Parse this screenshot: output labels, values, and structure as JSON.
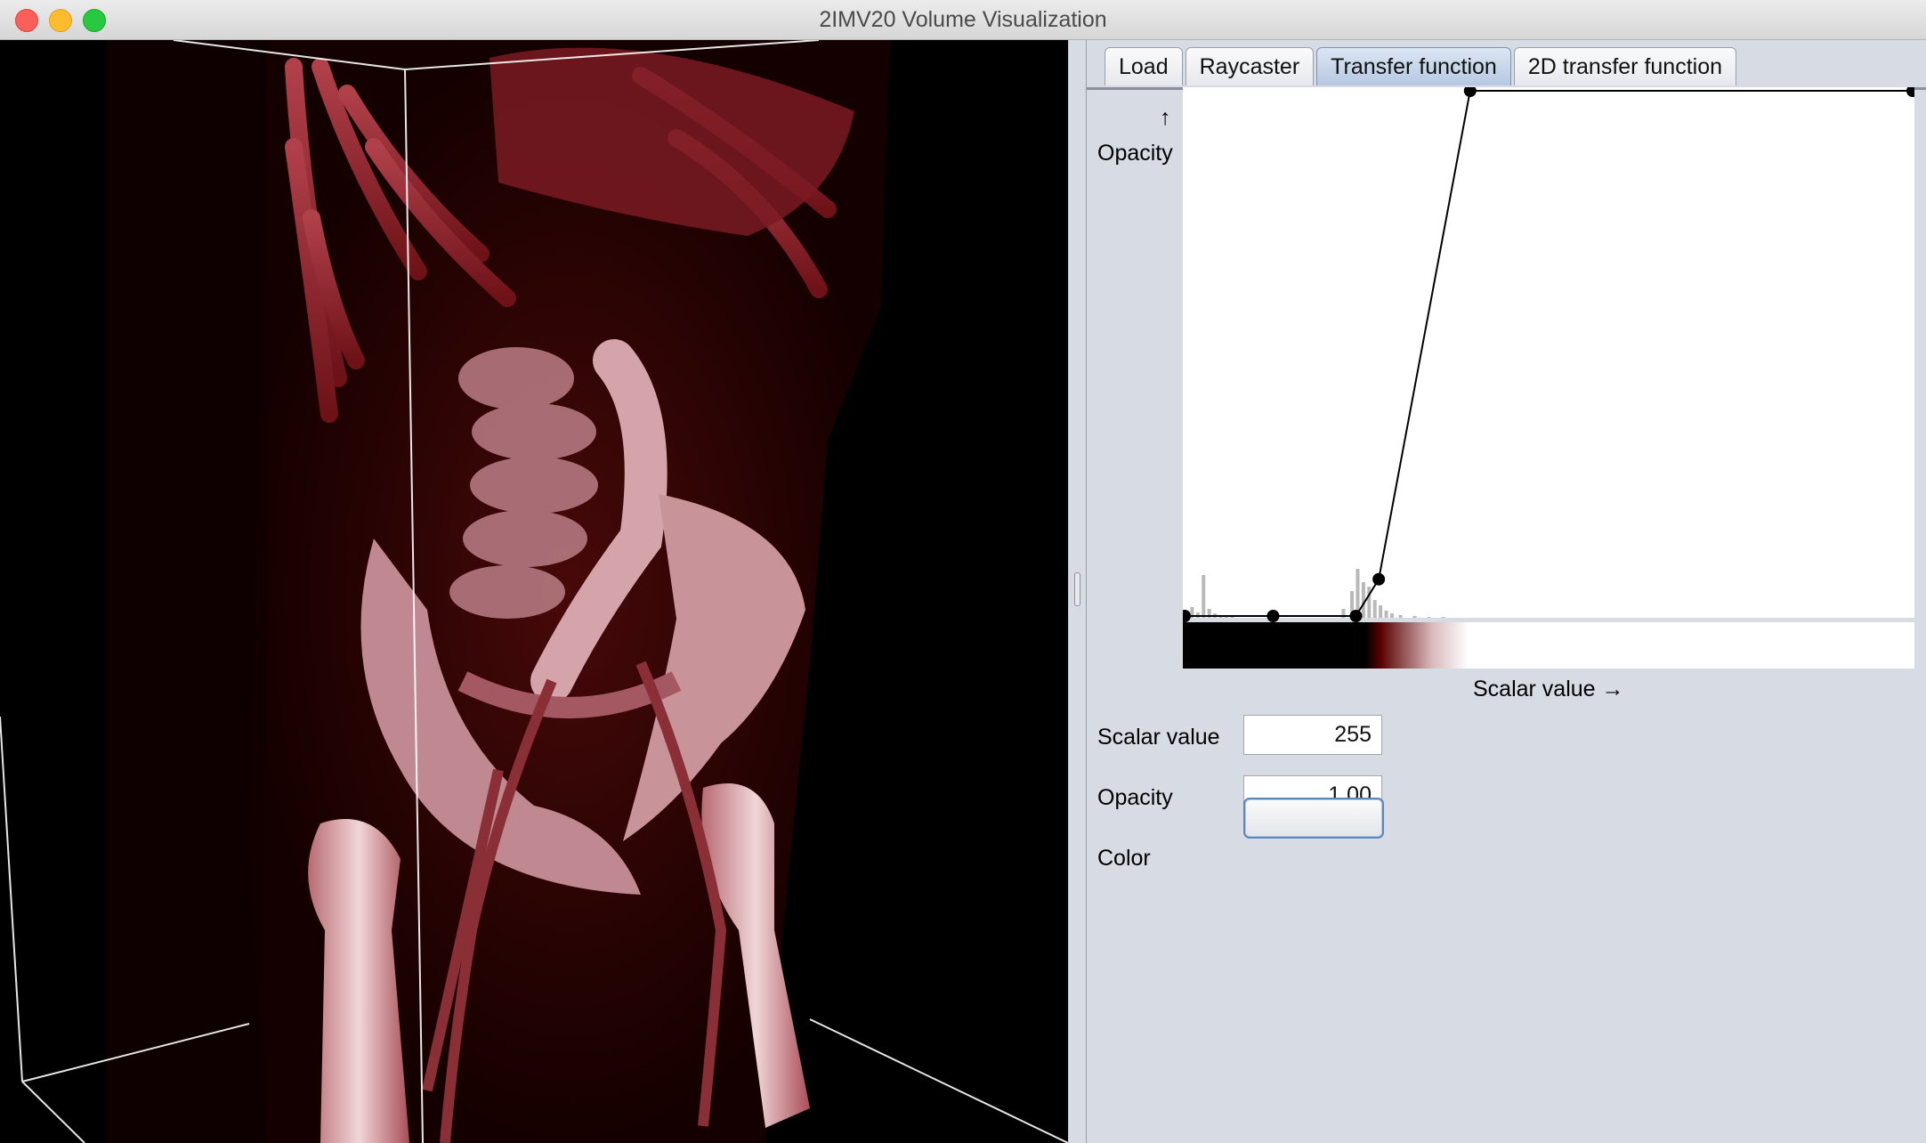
{
  "window": {
    "title": "2IMV20 Volume Visualization"
  },
  "tabs": [
    {
      "label": "Load",
      "active": false
    },
    {
      "label": "Raycaster",
      "active": false
    },
    {
      "label": "Transfer function",
      "active": true
    },
    {
      "label": "2D transfer function",
      "active": false
    }
  ],
  "transfer_function": {
    "y_label": "Opacity",
    "y_arrow": "↑",
    "x_label": "Scalar value →",
    "control_points": [
      {
        "scalar": 0,
        "opacity": 0.0
      },
      {
        "scalar": 31,
        "opacity": 0.0
      },
      {
        "scalar": 60,
        "opacity": 0.0
      },
      {
        "scalar": 68,
        "opacity": 0.07
      },
      {
        "scalar": 100,
        "opacity": 1.0
      },
      {
        "scalar": 255,
        "opacity": 1.0
      }
    ],
    "scalar_range": [
      0,
      255
    ],
    "colors": {
      "low": "#000000",
      "mid": "#5a0000",
      "high": "#ffffff",
      "curve": "#000000",
      "histogram": "#b9b9b9"
    }
  },
  "controls": {
    "scalar_value_label": "Scalar value",
    "scalar_value": "255",
    "opacity_label": "Opacity",
    "opacity_value": "1.00",
    "color_label": "Color"
  }
}
